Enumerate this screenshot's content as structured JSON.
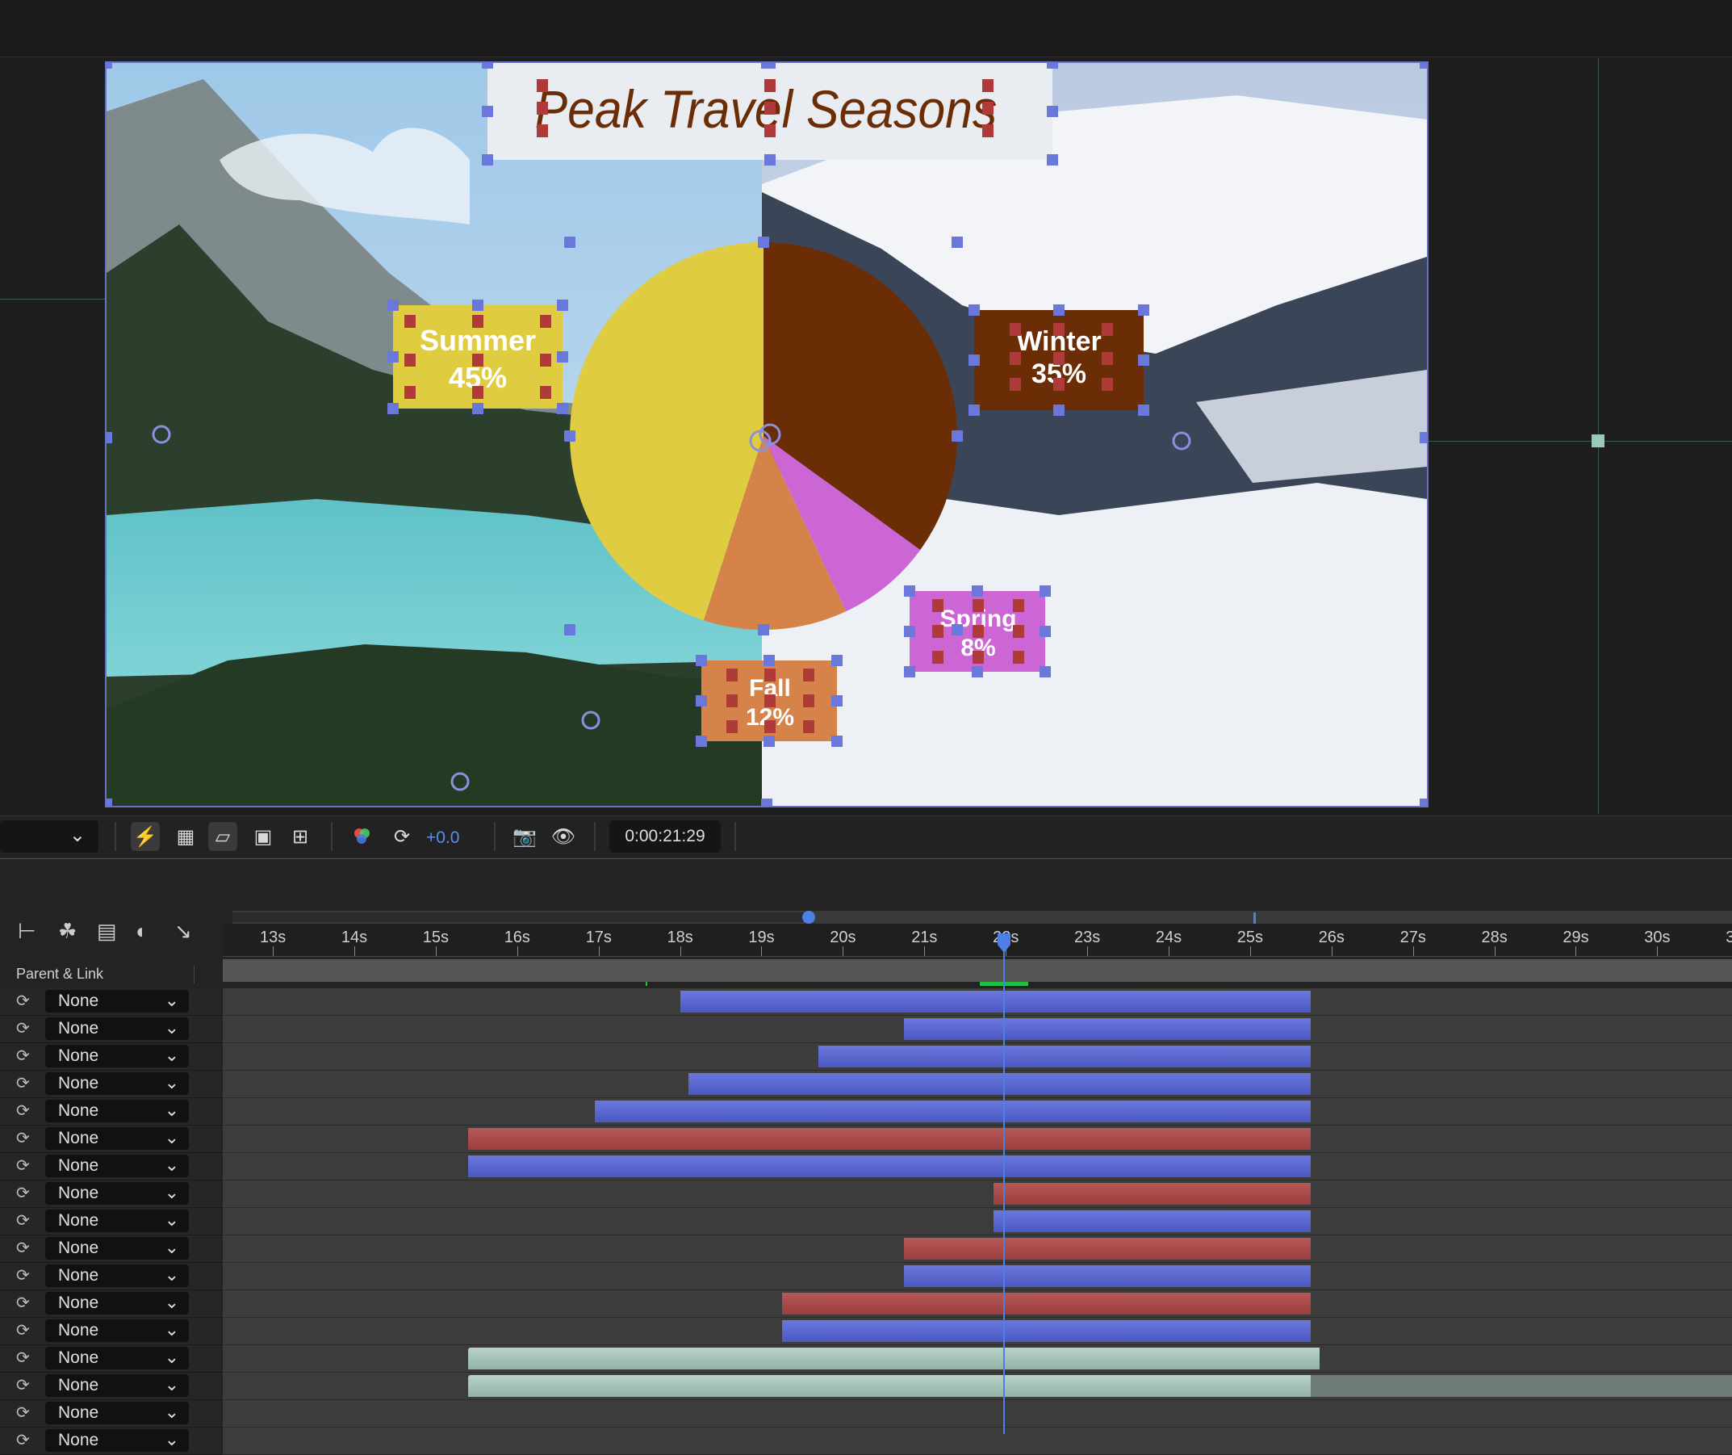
{
  "viewer": {
    "title_text": "Peak Travel Seasons",
    "labels": [
      {
        "name": "Summer",
        "value": "45%"
      },
      {
        "name": "Winter",
        "value": "35%"
      },
      {
        "name": "Spring",
        "value": "8%"
      },
      {
        "name": "Fall",
        "value": "12%"
      }
    ]
  },
  "chart_data": {
    "type": "pie",
    "title": "Peak Travel Seasons",
    "categories": [
      "Summer",
      "Winter",
      "Spring",
      "Fall"
    ],
    "values": [
      45,
      35,
      8,
      12
    ],
    "colors": {
      "Summer": "#e0cc40",
      "Winter": "#6b2d06",
      "Spring": "#cc66d4",
      "Fall": "#d6834a"
    }
  },
  "toolbar": {
    "exposure": "+0.0",
    "timecode": "0:00:21:29",
    "icons": [
      "fast-previews-icon",
      "transparency-grid-icon",
      "mask-path-icon",
      "region-of-interest-icon",
      "target-icon",
      "channels-icon",
      "exposure-reset-icon",
      "snapshot-icon",
      "show-snapshot-icon"
    ]
  },
  "timeline": {
    "column_header": "Parent & Link",
    "ruler_ticks": [
      "13s",
      "14s",
      "15s",
      "16s",
      "17s",
      "18s",
      "19s",
      "20s",
      "21s",
      "22s",
      "23s",
      "24s",
      "25s",
      "26s",
      "27s",
      "28s",
      "29s",
      "30s",
      "3"
    ],
    "playhead_time": "0:00:21:29",
    "layers": [
      {
        "parent": "None",
        "color": "blue",
        "in_s": 18.0,
        "out_s": 25.75
      },
      {
        "parent": "None",
        "color": "blue",
        "in_s": 20.75,
        "out_s": 25.75
      },
      {
        "parent": "None",
        "color": "blue",
        "in_s": 19.7,
        "out_s": 25.75
      },
      {
        "parent": "None",
        "color": "blue",
        "in_s": 18.1,
        "out_s": 25.75
      },
      {
        "parent": "None",
        "color": "blue",
        "in_s": 16.95,
        "out_s": 25.75
      },
      {
        "parent": "None",
        "color": "red",
        "in_s": 15.4,
        "out_s": 25.75
      },
      {
        "parent": "None",
        "color": "blue",
        "in_s": 15.4,
        "out_s": 25.75
      },
      {
        "parent": "None",
        "color": "red",
        "in_s": 21.85,
        "out_s": 25.75
      },
      {
        "parent": "None",
        "color": "blue",
        "in_s": 21.85,
        "out_s": 25.75
      },
      {
        "parent": "None",
        "color": "red",
        "in_s": 20.75,
        "out_s": 25.75
      },
      {
        "parent": "None",
        "color": "blue",
        "in_s": 20.75,
        "out_s": 25.75
      },
      {
        "parent": "None",
        "color": "red",
        "in_s": 19.25,
        "out_s": 25.75
      },
      {
        "parent": "None",
        "color": "blue",
        "in_s": 19.25,
        "out_s": 25.75
      },
      {
        "parent": "None",
        "color": "teal",
        "in_s": 15.4,
        "out_s": 25.85
      },
      {
        "parent": "None",
        "color": "teal",
        "in_s": 15.4,
        "out_s": 25.75
      },
      {
        "parent": "None",
        "color": "",
        "in_s": null,
        "out_s": null
      },
      {
        "parent": "None",
        "color": "",
        "in_s": null,
        "out_s": null
      }
    ]
  }
}
